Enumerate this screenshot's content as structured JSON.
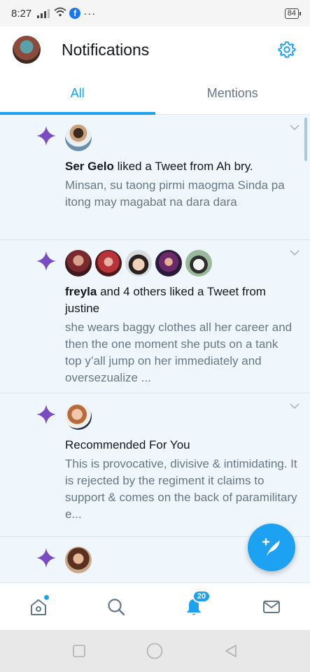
{
  "status_bar": {
    "time": "8:27",
    "battery": "84"
  },
  "header": {
    "title": "Notifications"
  },
  "tabs": [
    {
      "label": "All"
    },
    {
      "label": "Mentions"
    }
  ],
  "notifications": [
    {
      "actor": "Ser Gelo",
      "action": " liked a Tweet from Ah bry.",
      "text": "Minsan, su taong pirmi maogma Sinda pa itong may magabat na dara dara"
    },
    {
      "actor": "freyla",
      "action": " and 4 others liked a Tweet from justine",
      "text": "she wears baggy clothes all her career and then the one moment she puts on a tank top y’all jump on her immediately and oversezualize ..."
    },
    {
      "actor": "",
      "action": "Recommended For You",
      "text": "This is provocative, divisive & intimidating. It is rejected by the regiment it claims to support & comes on the back of paramilitary e..."
    },
    {
      "actor": "",
      "action": "",
      "text": ""
    }
  ],
  "bottom_nav": {
    "notifications_badge": "20"
  },
  "colors": {
    "accent": "#1da1f2",
    "spark": "#794bc4"
  }
}
